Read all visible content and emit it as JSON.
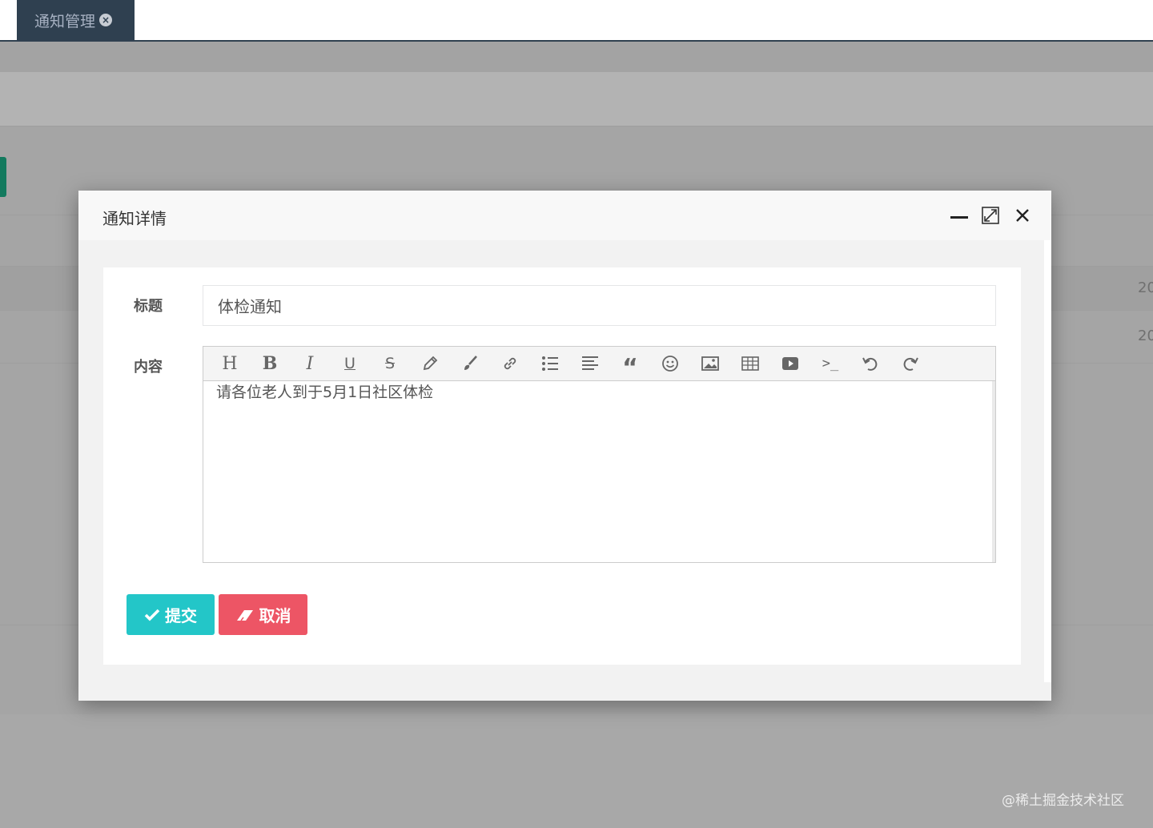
{
  "page": {
    "tab_label": "通知管理",
    "bg_row_text_1": "20",
    "bg_row_text_2": "20"
  },
  "modal": {
    "title": "通知详情",
    "form": {
      "title_label": "标题",
      "title_value": "体检通知",
      "content_label": "内容",
      "content_value": "请各位老人到于5月1日社区体检"
    },
    "toolbar": [
      "header-icon",
      "bold-icon",
      "italic-icon",
      "underline-icon",
      "strikethrough-icon",
      "pencil-icon",
      "brush-icon",
      "link-icon",
      "unordered-list-icon",
      "align-left-icon",
      "quote-icon",
      "smiley-icon",
      "image-icon",
      "table-icon",
      "video-icon",
      "code-icon",
      "undo-icon",
      "redo-icon"
    ],
    "buttons": {
      "submit": "提交",
      "cancel": "取消"
    }
  },
  "colors": {
    "nav_dark": "#2f4050",
    "submit": "#23c6c8",
    "cancel": "#ed5565"
  },
  "watermark": "@稀土掘金技术社区"
}
